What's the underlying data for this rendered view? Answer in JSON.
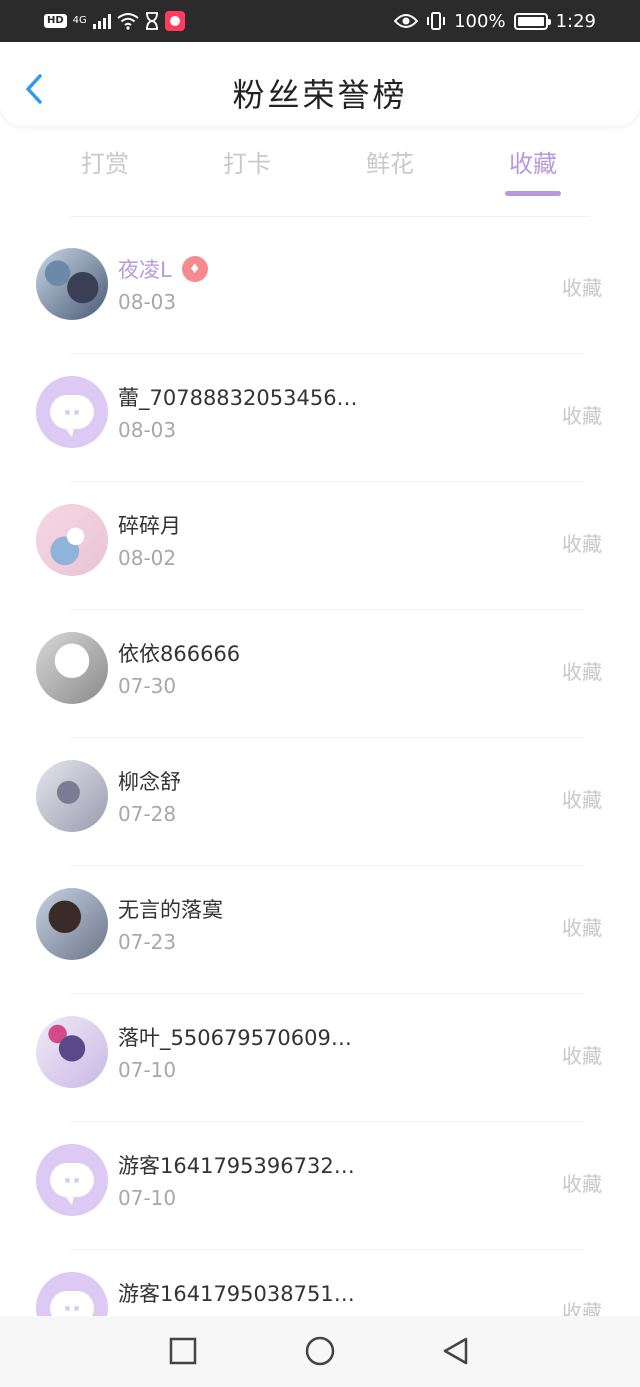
{
  "status_bar": {
    "hd_label": "HD",
    "network": "4G",
    "battery_percent": "100%",
    "time": "1:29"
  },
  "header": {
    "title": "粉丝荣誉榜",
    "back_icon": "chevron-left-icon",
    "accent_color": "#2d9cf0"
  },
  "tabs": [
    {
      "label": "打赏"
    },
    {
      "label": "打卡"
    },
    {
      "label": "鲜花"
    },
    {
      "label": "收藏"
    }
  ],
  "active_tab": "收藏",
  "colors": {
    "active": "#b79ad9",
    "inactive": "#c9c9c9",
    "vip_badge": "#f58a8f",
    "default_avatar": "#dcc9f4"
  },
  "fans": [
    {
      "name": "夜凌L",
      "date": "08-03",
      "action": "收藏",
      "avatar": "photo",
      "vip": true
    },
    {
      "name": "蕾_70788832053456…",
      "date": "08-03",
      "action": "收藏",
      "avatar": "default"
    },
    {
      "name": "碎碎月",
      "date": "08-02",
      "action": "收藏",
      "avatar": "photo"
    },
    {
      "name": "依依866666",
      "date": "07-30",
      "action": "收藏",
      "avatar": "photo"
    },
    {
      "name": "柳念舒",
      "date": "07-28",
      "action": "收藏",
      "avatar": "photo"
    },
    {
      "name": "无言的落寞",
      "date": "07-23",
      "action": "收藏",
      "avatar": "photo"
    },
    {
      "name": "落叶_550679570609…",
      "date": "07-10",
      "action": "收藏",
      "avatar": "photo"
    },
    {
      "name": "游客1641795396732…",
      "date": "07-10",
      "action": "收藏",
      "avatar": "default"
    },
    {
      "name": "游客1641795038751…",
      "date": "",
      "action": "收藏",
      "avatar": "default"
    }
  ],
  "nav_bar": {
    "buttons": [
      "recents-square-icon",
      "home-circle-icon",
      "back-triangle-icon"
    ]
  }
}
